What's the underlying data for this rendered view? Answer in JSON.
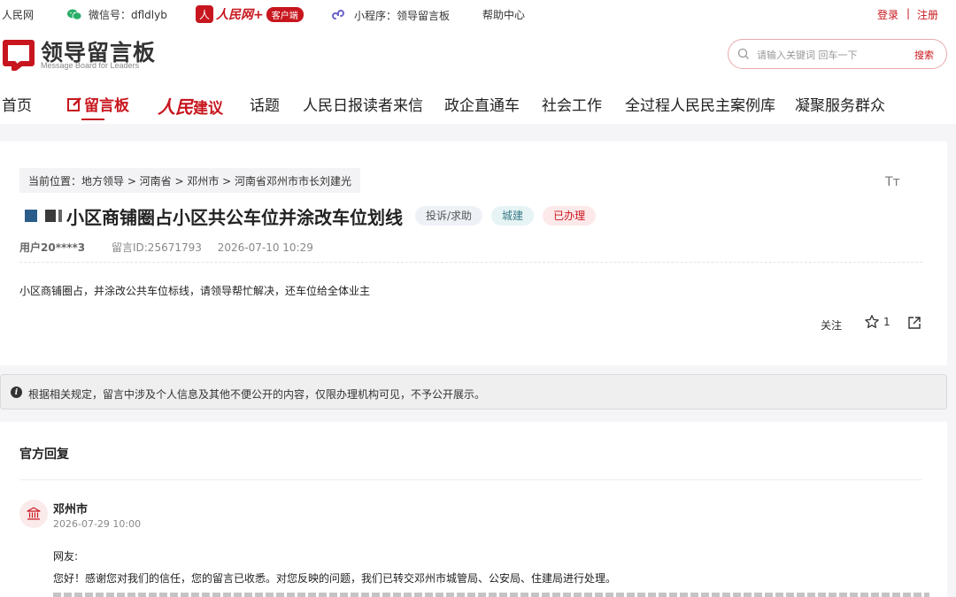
{
  "topbar": {
    "site": "人民网",
    "wechat": "微信号：dfldlyb",
    "people_daily_logo": "人",
    "people_daily_name": "人民网+",
    "people_daily_client": "客户端",
    "mini_program": "小程序：领导留言板",
    "help": "帮助中心",
    "login": "登录",
    "separator": "|",
    "register": "注册"
  },
  "header": {
    "title": "领导留言板",
    "subtitle": "Message Board for Leaders",
    "search_placeholder": "请输入关键词 回车一下",
    "search_button": "搜索"
  },
  "nav": {
    "items": [
      "首页",
      "留言板",
      "人民建议",
      "话题",
      "人民日报读者来信",
      "政企直通车",
      "社会工作",
      "全过程人民民主案例库",
      "凝聚服务群众"
    ],
    "active_index": 1,
    "brand_rm": "人民",
    "brand_jy": "建议"
  },
  "message": {
    "breadcrumb": "当前位置：地方领导 > 河南省 > 邓州市 > 河南省邓州市市长刘建光",
    "font_size_icon": "Tт",
    "title": "小区商铺圈占小区共公车位并涂改车位划线",
    "tags": [
      "投诉/求助",
      "城建",
      "已办理"
    ],
    "user": "用户20****3",
    "message_id": "留言ID:25671793",
    "datetime": "2026-07-10 10:29",
    "content": "小区商铺圈占，并涂改公共车位标线，请领导帮忙解决，还车位给全体业主",
    "follow": "关注",
    "star_count": "1"
  },
  "notice": {
    "icon": "i",
    "text": "根据相关规定，留言中涉及个人信息及其他不便公开的内容，仅限办理机构可见，不予公开展示。"
  },
  "reply": {
    "heading": "官方回复",
    "replier": "邓州市",
    "time": "2026-07-29 10:00",
    "salutation": "网友:",
    "text": "您好！感谢您对我们的信任，您的留言已收悉。对您反映的问题，我们已转交邓州市城管局、公安局、住建局进行处理。"
  },
  "colors": {
    "accent": "#c8161e",
    "wechat_green": "#2aae67",
    "mini_program_purple": "#6a63c9"
  }
}
